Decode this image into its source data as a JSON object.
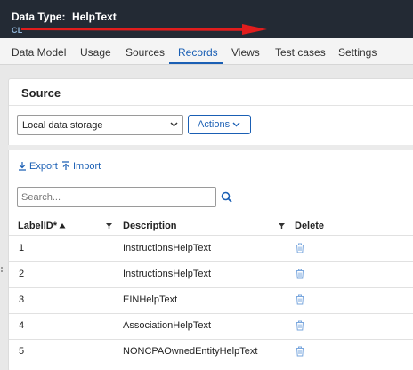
{
  "header": {
    "data_type_label": "Data Type:",
    "data_type_name": "HelpText",
    "class_badge": "CL"
  },
  "tabs": [
    {
      "label": "Data Model"
    },
    {
      "label": "Usage"
    },
    {
      "label": "Sources"
    },
    {
      "label": "Records"
    },
    {
      "label": "Views"
    },
    {
      "label": "Test cases"
    },
    {
      "label": "Settings"
    }
  ],
  "active_tab": "Records",
  "source": {
    "title": "Source",
    "selected": "Local data storage",
    "actions_label": "Actions"
  },
  "toolbar": {
    "export_label": "Export",
    "import_label": "Import"
  },
  "search": {
    "placeholder": "Search..."
  },
  "table": {
    "columns": {
      "label_id": "LabelID*",
      "description": "Description",
      "delete": "Delete"
    },
    "rows": [
      {
        "id": "1",
        "description": "InstructionsHelpText"
      },
      {
        "id": "2",
        "description": "InstructionsHelpText"
      },
      {
        "id": "3",
        "description": "EINHelpText"
      },
      {
        "id": "4",
        "description": "AssociationHelpText"
      },
      {
        "id": "5",
        "description": "NONCPAOwnedEntityHelpText"
      }
    ]
  },
  "colors": {
    "accent": "#1a5fb4",
    "header_bg": "#232a34",
    "annotation_arrow": "#e11d1d"
  },
  "icons": {
    "sort": "sort-ascending-icon",
    "filter": "filter-icon",
    "delete": "trash-icon",
    "search": "search-icon",
    "export": "export-icon",
    "import": "import-icon"
  }
}
